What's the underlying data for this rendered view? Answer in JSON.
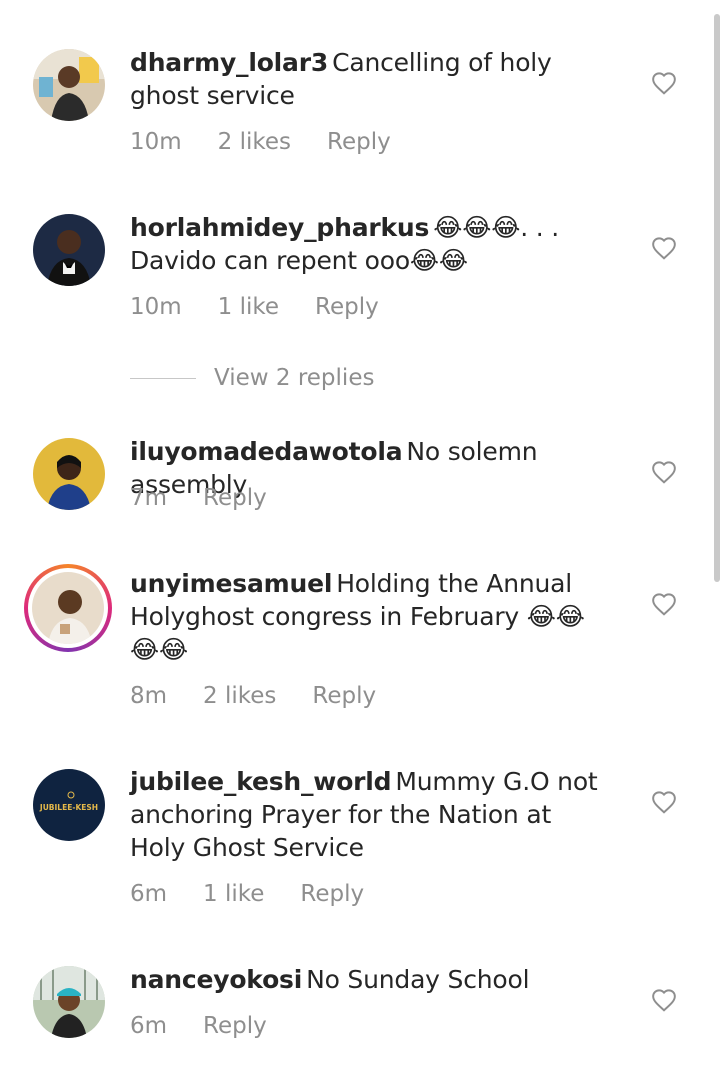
{
  "comments": [
    {
      "username": "dharmy_lolar3",
      "text": "Cancelling of holy ghost service",
      "time": "10m",
      "likes": "2 likes",
      "reply": "Reply"
    },
    {
      "username": "horlahmidey_pharkus",
      "text": "😂😂😂. . . Davido can repent ooo😂😂",
      "time": "10m",
      "likes": "1 like",
      "reply": "Reply"
    },
    {
      "username": "iluyomadedawotola",
      "text": "No solemn assembly",
      "time": "7m",
      "reply": "Reply"
    },
    {
      "username": "unyimesamuel",
      "text": "Holding the Annual Holyghost congress in February 😂😂😂😂",
      "time": "8m",
      "likes": "2 likes",
      "reply": "Reply"
    },
    {
      "username": "jubilee_kesh_world",
      "text": "Mummy G.O not anchoring Prayer for the Nation at Holy Ghost Service",
      "time": "6m",
      "likes": "1 like",
      "reply": "Reply"
    },
    {
      "username": "nanceyokosi",
      "text": "No Sunday School",
      "time": "6m",
      "reply": "Reply"
    }
  ],
  "view_replies": "View 2 replies",
  "avatars": {
    "jubilee_logo_text": "JUBILEE-KESH"
  },
  "colors": {
    "text": "#262626",
    "meta": "#8e8e8e",
    "story_ring": "#dd2a7b"
  }
}
